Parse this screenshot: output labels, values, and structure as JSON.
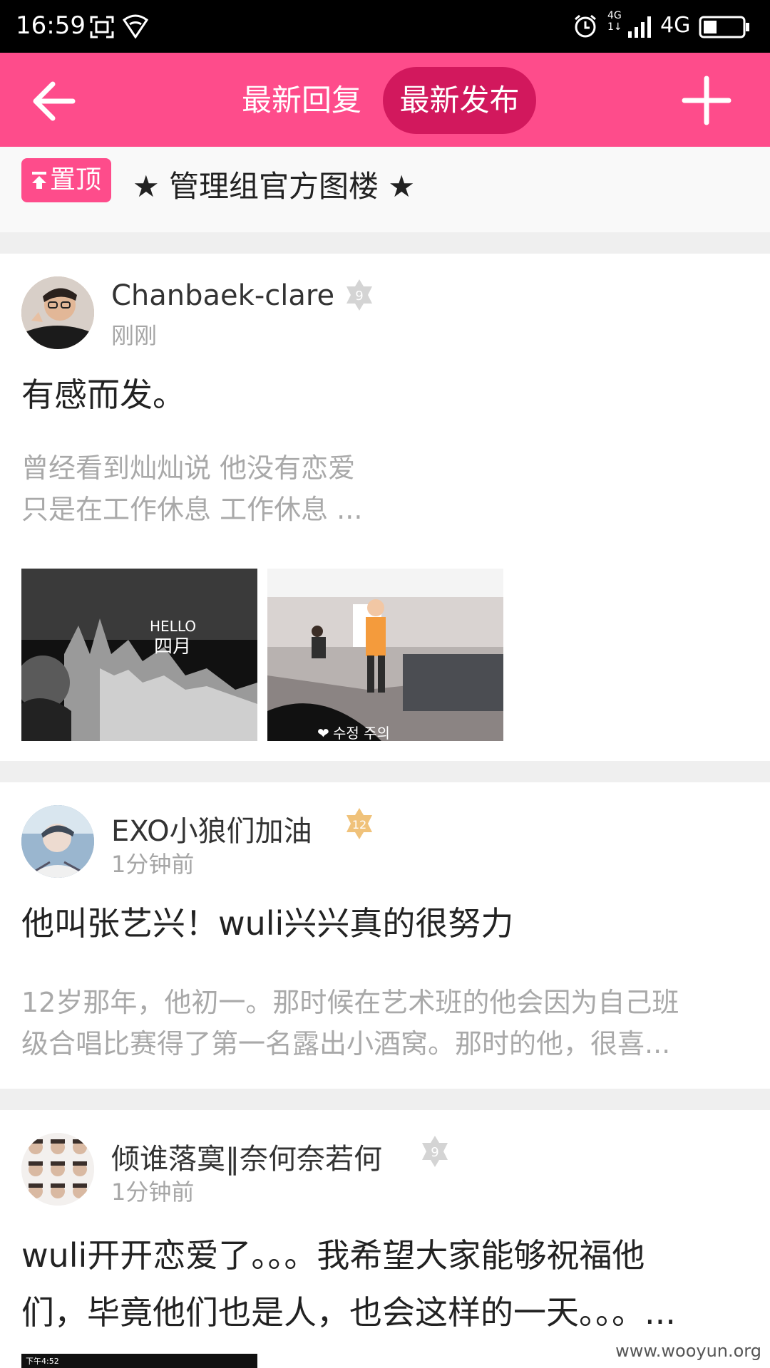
{
  "status": {
    "time": "16:59",
    "net_small_top": "4G",
    "net_small_bottom": "1↓",
    "network": "4G"
  },
  "header": {
    "tab_reply": "最新回复",
    "tab_new": "最新发布"
  },
  "pinned": {
    "badge": "置顶",
    "title": "★ 管理组官方图楼 ★"
  },
  "posts": [
    {
      "author": "Chanbaek-clare",
      "level": "9",
      "time": "刚刚",
      "title": "有感而发。",
      "excerpt_lines": [
        "曾经看到灿灿说  他没有恋爱",
        "只是在工作休息  工作休息  ..."
      ],
      "image_texts": [
        "HELLO",
        "四月",
        "수정 주의"
      ]
    },
    {
      "author": "EXO小狼们加油",
      "level": "12",
      "time": "1分钟前",
      "title": "他叫张艺兴！wuli兴兴真的很努力",
      "excerpt_lines": [
        "12岁那年，他初一。那时候在艺术班的他会因为自己班",
        "级合唱比赛得了第一名露出小酒窝。那时的他，很喜..."
      ]
    },
    {
      "author": "倾谁落寞‖奈何奈若何",
      "level": "9",
      "time": "1分钟前",
      "title_lines": [
        "wuli开开恋爱了。。。我希望大家能够祝福他",
        "们，毕竟他们也是人，也会这样的一天。。。..."
      ],
      "thumb_time": "下午4:52"
    }
  ],
  "watermark": "www.wooyun.org",
  "colors": {
    "brand": "#fe4c8b",
    "brand_dark": "#d2185d",
    "level_grey": "#d4d4d4",
    "level_gold": "#f0c27a"
  }
}
